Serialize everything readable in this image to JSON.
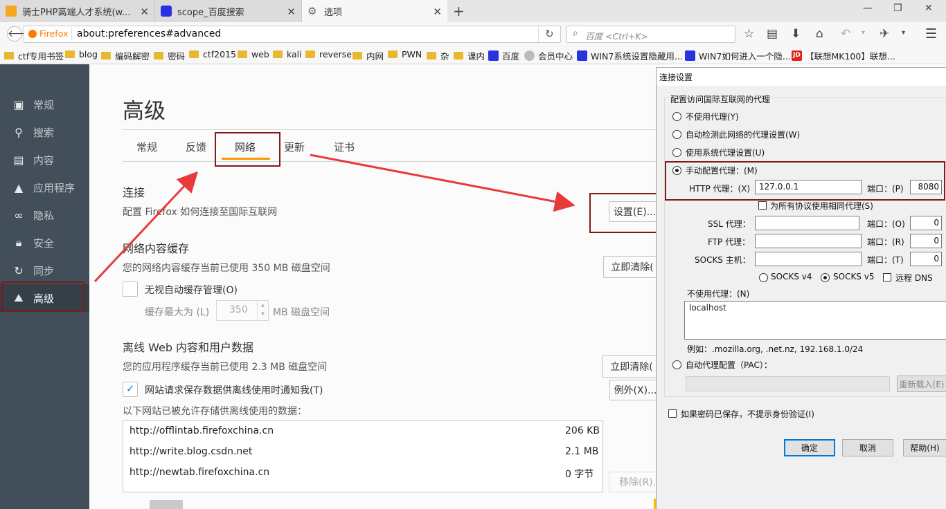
{
  "tabs": [
    {
      "title": "骑士PHP高端人才系统(w...",
      "icon": "brand-icon-orange"
    },
    {
      "title": "scope_百度搜索",
      "icon": "baidu-paw-icon"
    },
    {
      "title": "选项",
      "icon": "gear-icon"
    }
  ],
  "nav": {
    "identity_label": "Firefox",
    "url": "about:preferences#advanced",
    "search_placeholder": "百度 <Ctrl+K>"
  },
  "bookmarks": [
    {
      "label": "ctf专用书签",
      "type": "folder"
    },
    {
      "label": "blog",
      "type": "folder"
    },
    {
      "label": "编码解密",
      "type": "folder"
    },
    {
      "label": "密码",
      "type": "folder"
    },
    {
      "label": "ctf2015",
      "type": "folder"
    },
    {
      "label": "web",
      "type": "folder"
    },
    {
      "label": "kali",
      "type": "folder"
    },
    {
      "label": "reverse",
      "type": "folder"
    },
    {
      "label": "内网",
      "type": "folder"
    },
    {
      "label": "PWN",
      "type": "folder"
    },
    {
      "label": "杂",
      "type": "folder"
    },
    {
      "label": "课内",
      "type": "folder"
    },
    {
      "label": "百度",
      "type": "baidu"
    },
    {
      "label": "会员中心",
      "type": "globe"
    },
    {
      "label": "WIN7系统设置隐藏用...",
      "type": "baidu"
    },
    {
      "label": "WIN7如何进入一个隐...",
      "type": "baidu"
    },
    {
      "label": "【联想MK100】联想...",
      "type": "jd"
    }
  ],
  "sidebar": [
    {
      "label": "常规",
      "icon": "general-icon"
    },
    {
      "label": "搜索",
      "icon": "search-icon"
    },
    {
      "label": "内容",
      "icon": "content-icon"
    },
    {
      "label": "应用程序",
      "icon": "rocket-icon"
    },
    {
      "label": "隐私",
      "icon": "mask-icon"
    },
    {
      "label": "安全",
      "icon": "lock-icon"
    },
    {
      "label": "同步",
      "icon": "sync-icon"
    },
    {
      "label": "高级",
      "icon": "wizard-hat-icon",
      "selected": true
    }
  ],
  "main": {
    "title": "高级",
    "tabs": [
      "常规",
      "反馈",
      "网络",
      "更新",
      "证书"
    ],
    "active_tab": "网络",
    "connection": {
      "heading": "连接",
      "desc": "配置 Firefox 如何连接至国际互联网",
      "settings_button": "设置(E)..."
    },
    "cache": {
      "heading": "网络内容缓存",
      "usage": "您的网络内容缓存当前已使用 350 MB 磁盘空间",
      "clear_button": "立即清除(",
      "override_label": "无视自动缓存管理(O)",
      "limit_label": "缓存最大为 (L)",
      "limit_value": "350",
      "limit_unit": "MB 磁盘空间"
    },
    "offline": {
      "heading": "离线 Web 内容和用户数据",
      "usage": "您的应用程序缓存当前已使用 2.3 MB 磁盘空间",
      "clear_button": "立即清除(",
      "notify_label": "网站请求保存数据供离线使用时通知我(T)",
      "exceptions_button": "例外(X)...",
      "list_label": "以下网站已被允许存储供离线使用的数据：",
      "sites": [
        {
          "url": "http://offlintab.firefoxchina.cn",
          "size": "206 KB"
        },
        {
          "url": "http://write.blog.csdn.net",
          "size": "2.1 MB"
        },
        {
          "url": "http://newtab.firefoxchina.cn",
          "size": "0 字节"
        }
      ],
      "remove_button": "移除(R)..."
    }
  },
  "dialog": {
    "title": "连接设置",
    "section": "配置访问国际互联网的代理",
    "options": {
      "none": "不使用代理(Y)",
      "auto_detect": "自动检测此网络的代理设置(W)",
      "system": "使用系统代理设置(U)",
      "manual": "手动配置代理：(M)",
      "pac": "自动代理配置（PAC）："
    },
    "http_label": "HTTP 代理：(X)",
    "http_value": "127.0.0.1",
    "port_label_p": "端口：(P)",
    "http_port": "8080",
    "share_label": "为所有协议使用相同代理(S)",
    "ssl_label": "SSL 代理：",
    "ftp_label": "FTP 代理：",
    "socks_label": "SOCKS 主机：",
    "port_label_o": "端口：(O)",
    "port_label_r": "端口：(R)",
    "port_label_t": "端口：(T)",
    "zero": "0",
    "socks_v4": "SOCKS v4",
    "socks_v5": "SOCKS v5",
    "remote_dns": "远程 DNS",
    "no_proxy_label": "不使用代理：(N)",
    "no_proxy_value": "localhost",
    "example": "例如：.mozilla.org, .net.nz, 192.168.1.0/24",
    "reload_button": "重新载入(E)",
    "no_auth_label": "如果密码已保存，不提示身份验证(I)",
    "ok": "确定",
    "cancel": "取消",
    "help": "帮助(H)"
  },
  "colors": {
    "accent_tab": "#ff9500",
    "highlight_box": "#7d1a1a",
    "arrow": "#e8393c",
    "sidebar_bg": "#424f5a"
  }
}
